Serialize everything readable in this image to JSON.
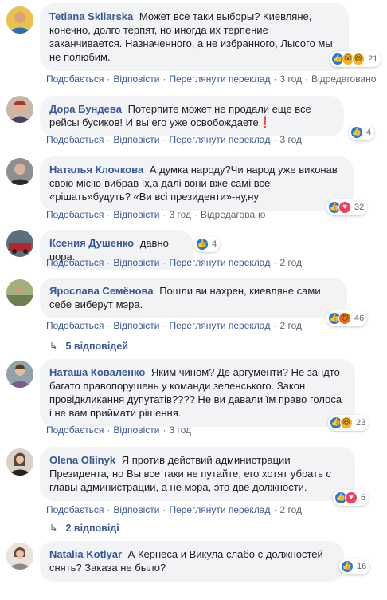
{
  "action_labels": {
    "like": "Подобається",
    "reply": "Відповісти",
    "translate": "Переглянути переклад",
    "edited": "Відредаговано"
  },
  "comments": [
    {
      "author": "Tetiana Skliarska",
      "text": "Может все таки выборы? Киевляне, конечно, долго терпят, но иногда их терпение заканчивается. Назначенного, а не избранного, Лысого мы не полюбим.",
      "reactions": [
        "like",
        "wow",
        "haha"
      ],
      "count": "21",
      "time": "3 год"
    },
    {
      "author": "Дора Бундева",
      "text": "Потерпите может не продали еще все рейсы бусиков! И вы его уже освобождаете❗",
      "reactions": [
        "like"
      ],
      "count": "4",
      "time": "3 год"
    },
    {
      "author": "Наталья Клочкова",
      "text": "А думка народу?Чи народ уже виконав свою місію-вибрав їх,а далі вони вже самі все «рішать»будуть? «Ви всі президенти»-ну,ну",
      "reactions": [
        "like",
        "love"
      ],
      "count": "32",
      "time": "3 год"
    },
    {
      "author": "Ксения Душенко",
      "text": "давно пора.",
      "reactions": [
        "like"
      ],
      "count": "4",
      "time": "2 год"
    },
    {
      "author": "Ярослава Семёнова",
      "text": "Пошли ви нахрен, киевляне сами себе виберут мэра.",
      "reactions": [
        "like",
        "angry"
      ],
      "count": "46",
      "time": "2 год",
      "replies": "5 відповідей"
    },
    {
      "author": "Наташа Коваленко",
      "text": "Яким чином? Де аргументи? Не зандто багато правопорушень у команди зеленського. Закон провідкликання дупутатів???? Не ви давали їм право голоса і не вам приймати рішення.",
      "reactions": [
        "like",
        "haha"
      ],
      "count": "23",
      "time": "3 год"
    },
    {
      "author": "Olena Oliinyk",
      "text": "Я против действий администрации Президента, но Вы все таки не путайте, его хотят убрать с главы администрации, а не мэра, это две должности.",
      "reactions": [
        "like",
        "love"
      ],
      "count": "6",
      "time": "2 год",
      "replies": "2 відповіді"
    },
    {
      "author": "Natalia Kotlyar",
      "text": "А Кернеса и Викула слабо с должностей снять? Заказа не было?",
      "reactions": [
        "like"
      ],
      "count": "16"
    }
  ],
  "colors": {
    "link": "#385898",
    "bubble": "#f2f3f5",
    "like": "#1877f2",
    "love": "#f33e58",
    "wow": "#f7b125"
  }
}
